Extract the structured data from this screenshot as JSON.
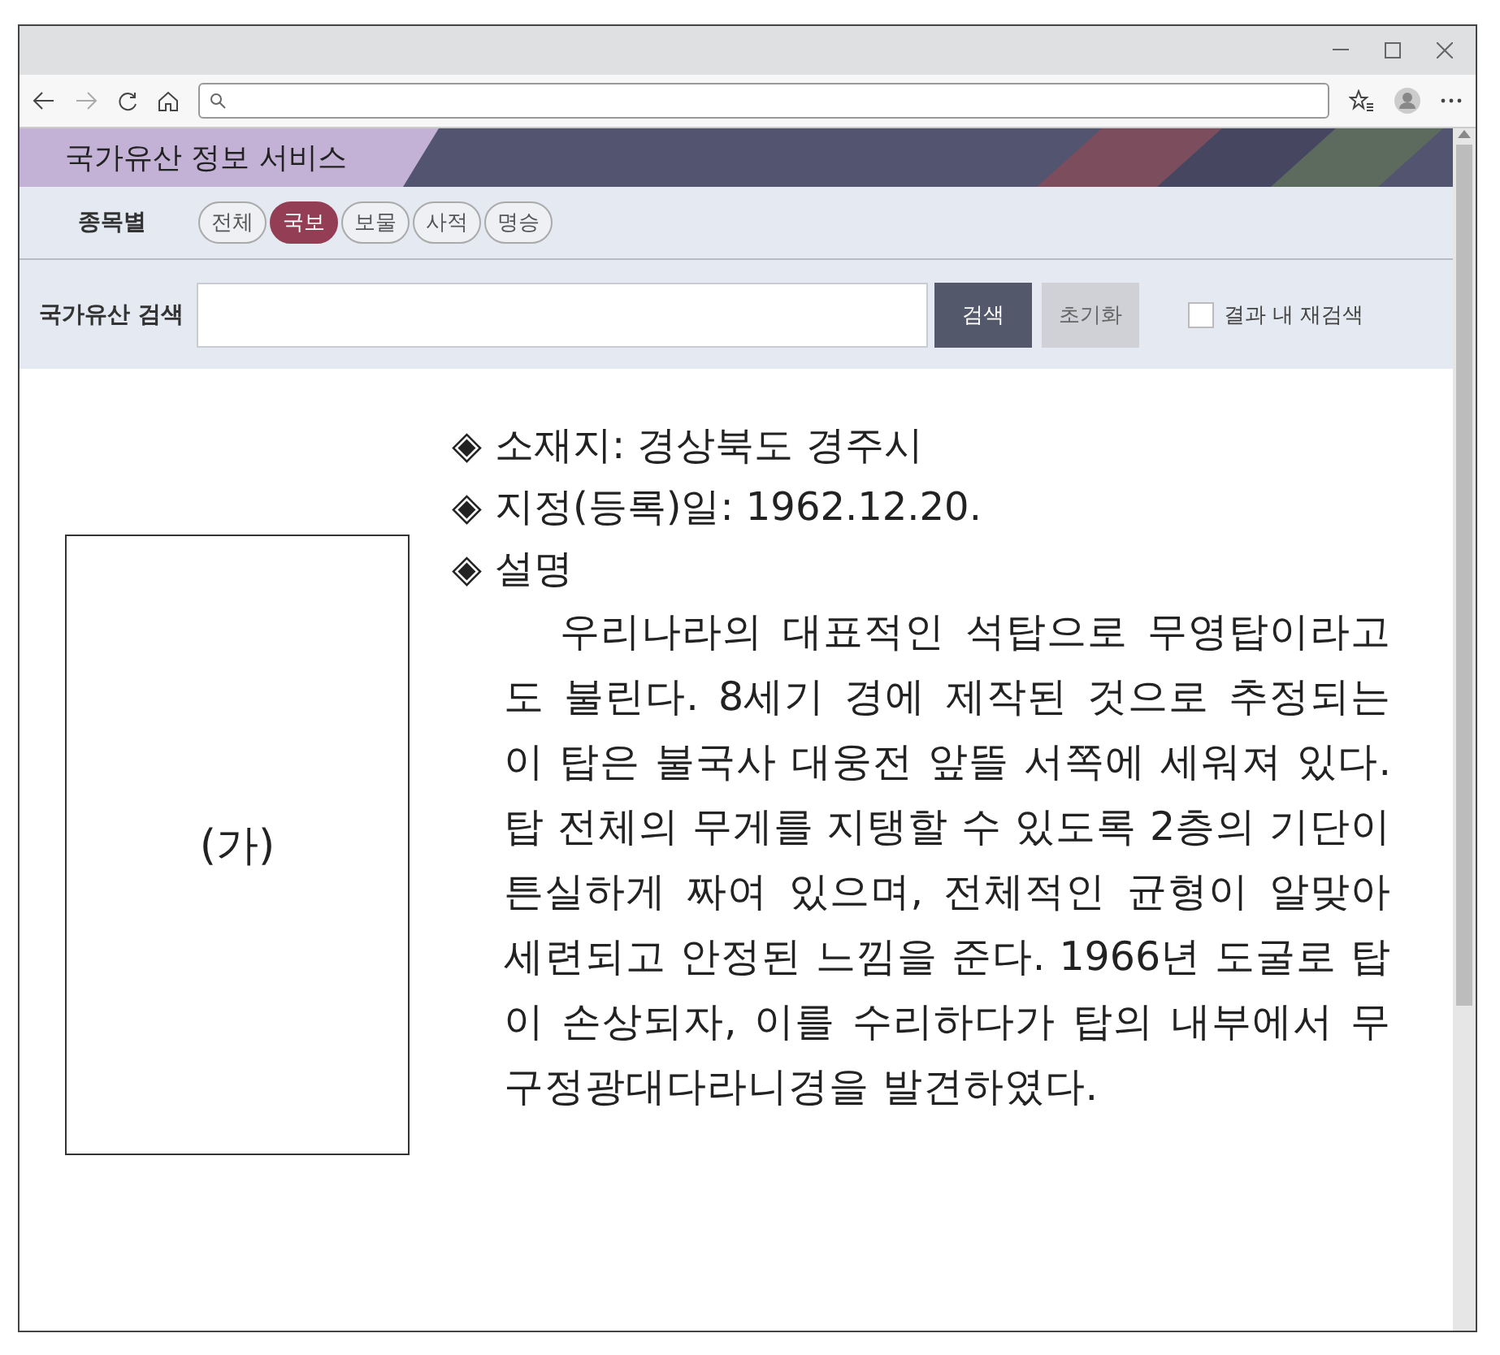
{
  "banner": {
    "title": "국가유산 정보 서비스"
  },
  "category": {
    "label": "종목별",
    "chips": [
      {
        "label": "전체",
        "selected": false
      },
      {
        "label": "국보",
        "selected": true
      },
      {
        "label": "보물",
        "selected": false
      },
      {
        "label": "사적",
        "selected": false
      },
      {
        "label": "명승",
        "selected": false
      }
    ]
  },
  "search": {
    "label": "국가유산 검색",
    "buttons": [
      "검색",
      "초기화"
    ],
    "refine": {
      "label": "결과 내 재검색",
      "checked": false
    }
  },
  "content": {
    "figure_label": "(가)",
    "items": [
      {
        "marker": "◈",
        "text": "소재지: 경상북도 경주시"
      },
      {
        "marker": "◈",
        "text": "지정(등록)일: 1962.12.20."
      },
      {
        "marker": "◈",
        "text": "설명"
      }
    ],
    "description": "우리나라의 대표적인 석탑으로 무영탑이라고도 불린다. 8세기 경에 제작된 것으로 추정되는 이 탑은 불국사 대웅전 앞뜰 서쪽에 세워져 있다. 탑 전체의 무게를 지탱할 수 있도록 2층의 기단이 튼실하게 짜여 있으며, 전체적인 균형이 알맞아 세련되고 안정된 느낌을 준다. 1966년 도굴로 탑이 손상되자, 이를 수리하다가 탑의 내부에서 무구정광대다라니경을 발견하였다."
  }
}
